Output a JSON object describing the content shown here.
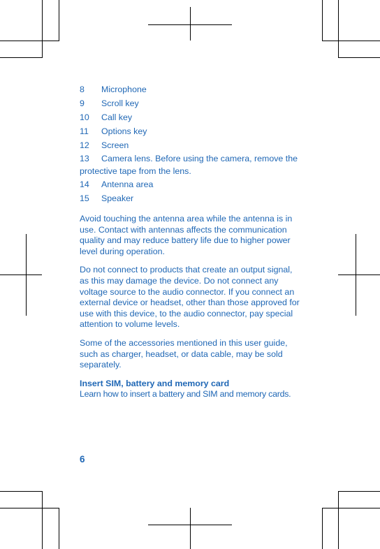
{
  "document": {
    "text_color": "#1f67b5",
    "page_number": "6",
    "parts_list": [
      {
        "number": "8",
        "label": "Microphone"
      },
      {
        "number": "9",
        "label": "Scroll key"
      },
      {
        "number": "10",
        "label": "Call key"
      },
      {
        "number": "11",
        "label": "Options key"
      },
      {
        "number": "12",
        "label": "Screen"
      },
      {
        "number": "13",
        "label": "Camera lens. Before using the camera, remove the protective tape from the lens."
      },
      {
        "number": "14",
        "label": "Antenna area"
      },
      {
        "number": "15",
        "label": "Speaker"
      }
    ],
    "paragraphs": [
      "Avoid touching the antenna area while the antenna is in use. Contact with antennas affects the communication quality and may reduce battery life due to higher power level during operation.",
      "Do not connect to products that create an output signal, as this may damage the device. Do not connect any voltage source to the audio connector. If you connect an external device or headset, other than those approved for use with this device, to the audio connector, pay special attention to volume levels.",
      "Some of the accessories mentioned in this user guide, such as charger, headset, or data cable, may be sold separately."
    ],
    "section": {
      "heading": "Insert SIM, battery and memory card",
      "subtext": "Learn how to insert a battery and SIM and memory cards."
    }
  },
  "print_marks": {
    "color": "#000000",
    "description": "crop-and-registration-marks"
  }
}
